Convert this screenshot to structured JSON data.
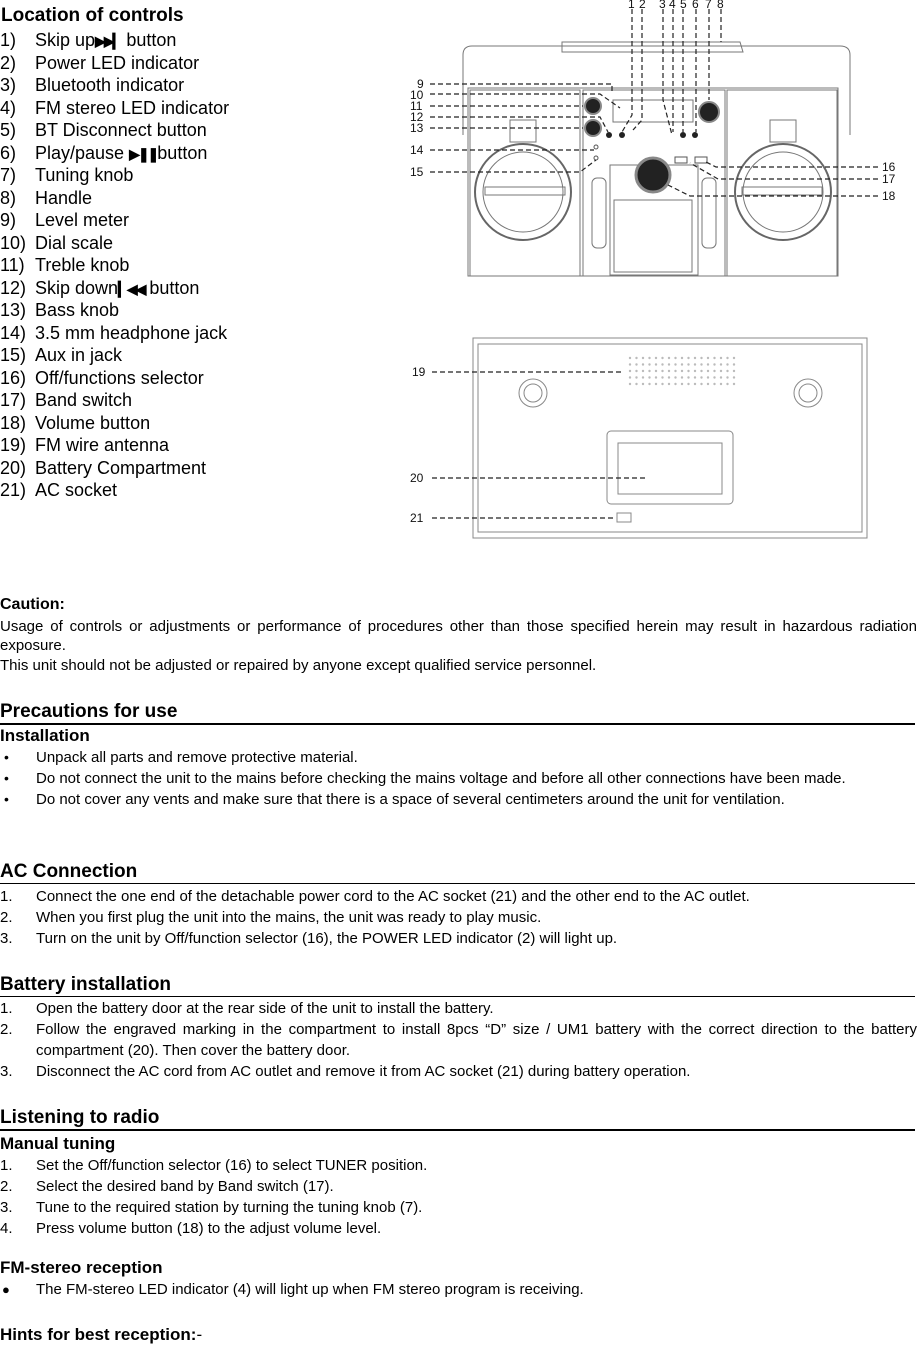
{
  "controls": {
    "title": "Location of controls",
    "items": [
      {
        "num": "1)",
        "label": "Skip up",
        "icon": "skip-next-icon",
        "glyph": "▶▶▎",
        "suffix": " button"
      },
      {
        "num": "2)",
        "label": "Power LED indicator"
      },
      {
        "num": "3)",
        "label": "Bluetooth indicator"
      },
      {
        "num": "4)",
        "label": "FM stereo LED indicator"
      },
      {
        "num": "5)",
        "label": "BT Disconnect button"
      },
      {
        "num": "6)",
        "label": "Play/pause ",
        "icon": "play-pause-icon",
        "glyph": "▶❚❚",
        "suffix": "button"
      },
      {
        "num": "7)",
        "label": "Tuning knob"
      },
      {
        "num": "8)",
        "label": "Handle"
      },
      {
        "num": "9)",
        "label": "Level meter"
      },
      {
        "num": "10)",
        "label": "Dial scale"
      },
      {
        "num": "11)",
        "label": "Treble knob"
      },
      {
        "num": "12)",
        "label": "Skip down",
        "icon": "skip-previous-icon",
        "glyph": "▎◀◀",
        "suffix": " button"
      },
      {
        "num": "13)",
        "label": "Bass knob"
      },
      {
        "num": "14)",
        "label": "3.5 mm headphone jack"
      },
      {
        "num": "15)",
        "label": "Aux in jack"
      },
      {
        "num": "16)",
        "label": "Off/functions selector"
      },
      {
        "num": "17)",
        "label": "Band switch"
      },
      {
        "num": "18)",
        "label": "Volume button"
      },
      {
        "num": "19)",
        "label": "FM wire antenna"
      },
      {
        "num": "20)",
        "label": "Battery Compartment"
      },
      {
        "num": "21)",
        "label": "AC socket"
      }
    ]
  },
  "front_diagram": {
    "top_callouts": [
      "1",
      "2",
      "3",
      "4",
      "5",
      "6",
      "7",
      "8"
    ],
    "left_callouts": [
      "9",
      "10",
      "11",
      "12",
      "13",
      "14",
      "15"
    ],
    "right_callouts": [
      "16",
      "17",
      "18"
    ]
  },
  "rear_diagram": {
    "left_callouts": [
      "19",
      "20",
      "21"
    ]
  },
  "caution": {
    "heading": "Caution:",
    "paragraph1": "Usage of controls or adjustments or performance of procedures other than those specified herein may result in hazardous radiation exposure.",
    "paragraph2": "This unit should not be adjusted or repaired by anyone except qualified service personnel."
  },
  "precautions": {
    "heading": "Precautions for use",
    "subheading": "Installation",
    "bullets": [
      "Unpack all parts and remove protective material.",
      "Do not connect the unit to the mains before checking the mains voltage and before all other connections have been made.",
      "Do not cover any vents and make sure that there is a space of several centimeters around the unit for ventilation."
    ]
  },
  "ac_connection": {
    "heading": "AC Connection",
    "steps": [
      {
        "n": "1.",
        "text": "Connect the one end of the detachable power cord to the AC socket (21) and the other end to the AC outlet."
      },
      {
        "n": "2.",
        "text": "When you first plug the unit into the mains, the unit was ready to play music."
      },
      {
        "n": "3.",
        "text": "Turn on the unit by Off/function selector (16), the POWER LED indicator (2) will light up."
      }
    ]
  },
  "battery": {
    "heading": "Battery installation",
    "steps": [
      {
        "n": "1.",
        "text": "Open the battery door at the rear side of the unit to install the battery."
      },
      {
        "n": "2.",
        "text": "Follow the engraved marking in the compartment to install 8pcs “D” size / UM1 battery with the correct direction to the battery compartment (20). Then cover the battery door."
      },
      {
        "n": "3.",
        "text": "Disconnect the AC cord from AC outlet and remove it from AC socket (21) during battery operation."
      }
    ]
  },
  "radio": {
    "heading": "Listening to radio",
    "manual_heading": "Manual tuning",
    "manual_steps": [
      {
        "n": "1.",
        "text": "Set the Off/function selector (16) to select TUNER position."
      },
      {
        "n": "2.",
        "text": "Select the desired band by Band switch (17)."
      },
      {
        "n": "3.",
        "text": "Tune to the required station by turning the tuning knob (7)."
      },
      {
        "n": "4.",
        "text": "Press volume button (18) to the adjust volume level."
      }
    ],
    "fm_heading": "FM-stereo reception",
    "fm_bullets": [
      "The FM-stereo LED indicator (4) will light up when FM stereo program is receiving."
    ],
    "hints_heading": "Hints for best reception:",
    "hints_suffix": "-"
  }
}
